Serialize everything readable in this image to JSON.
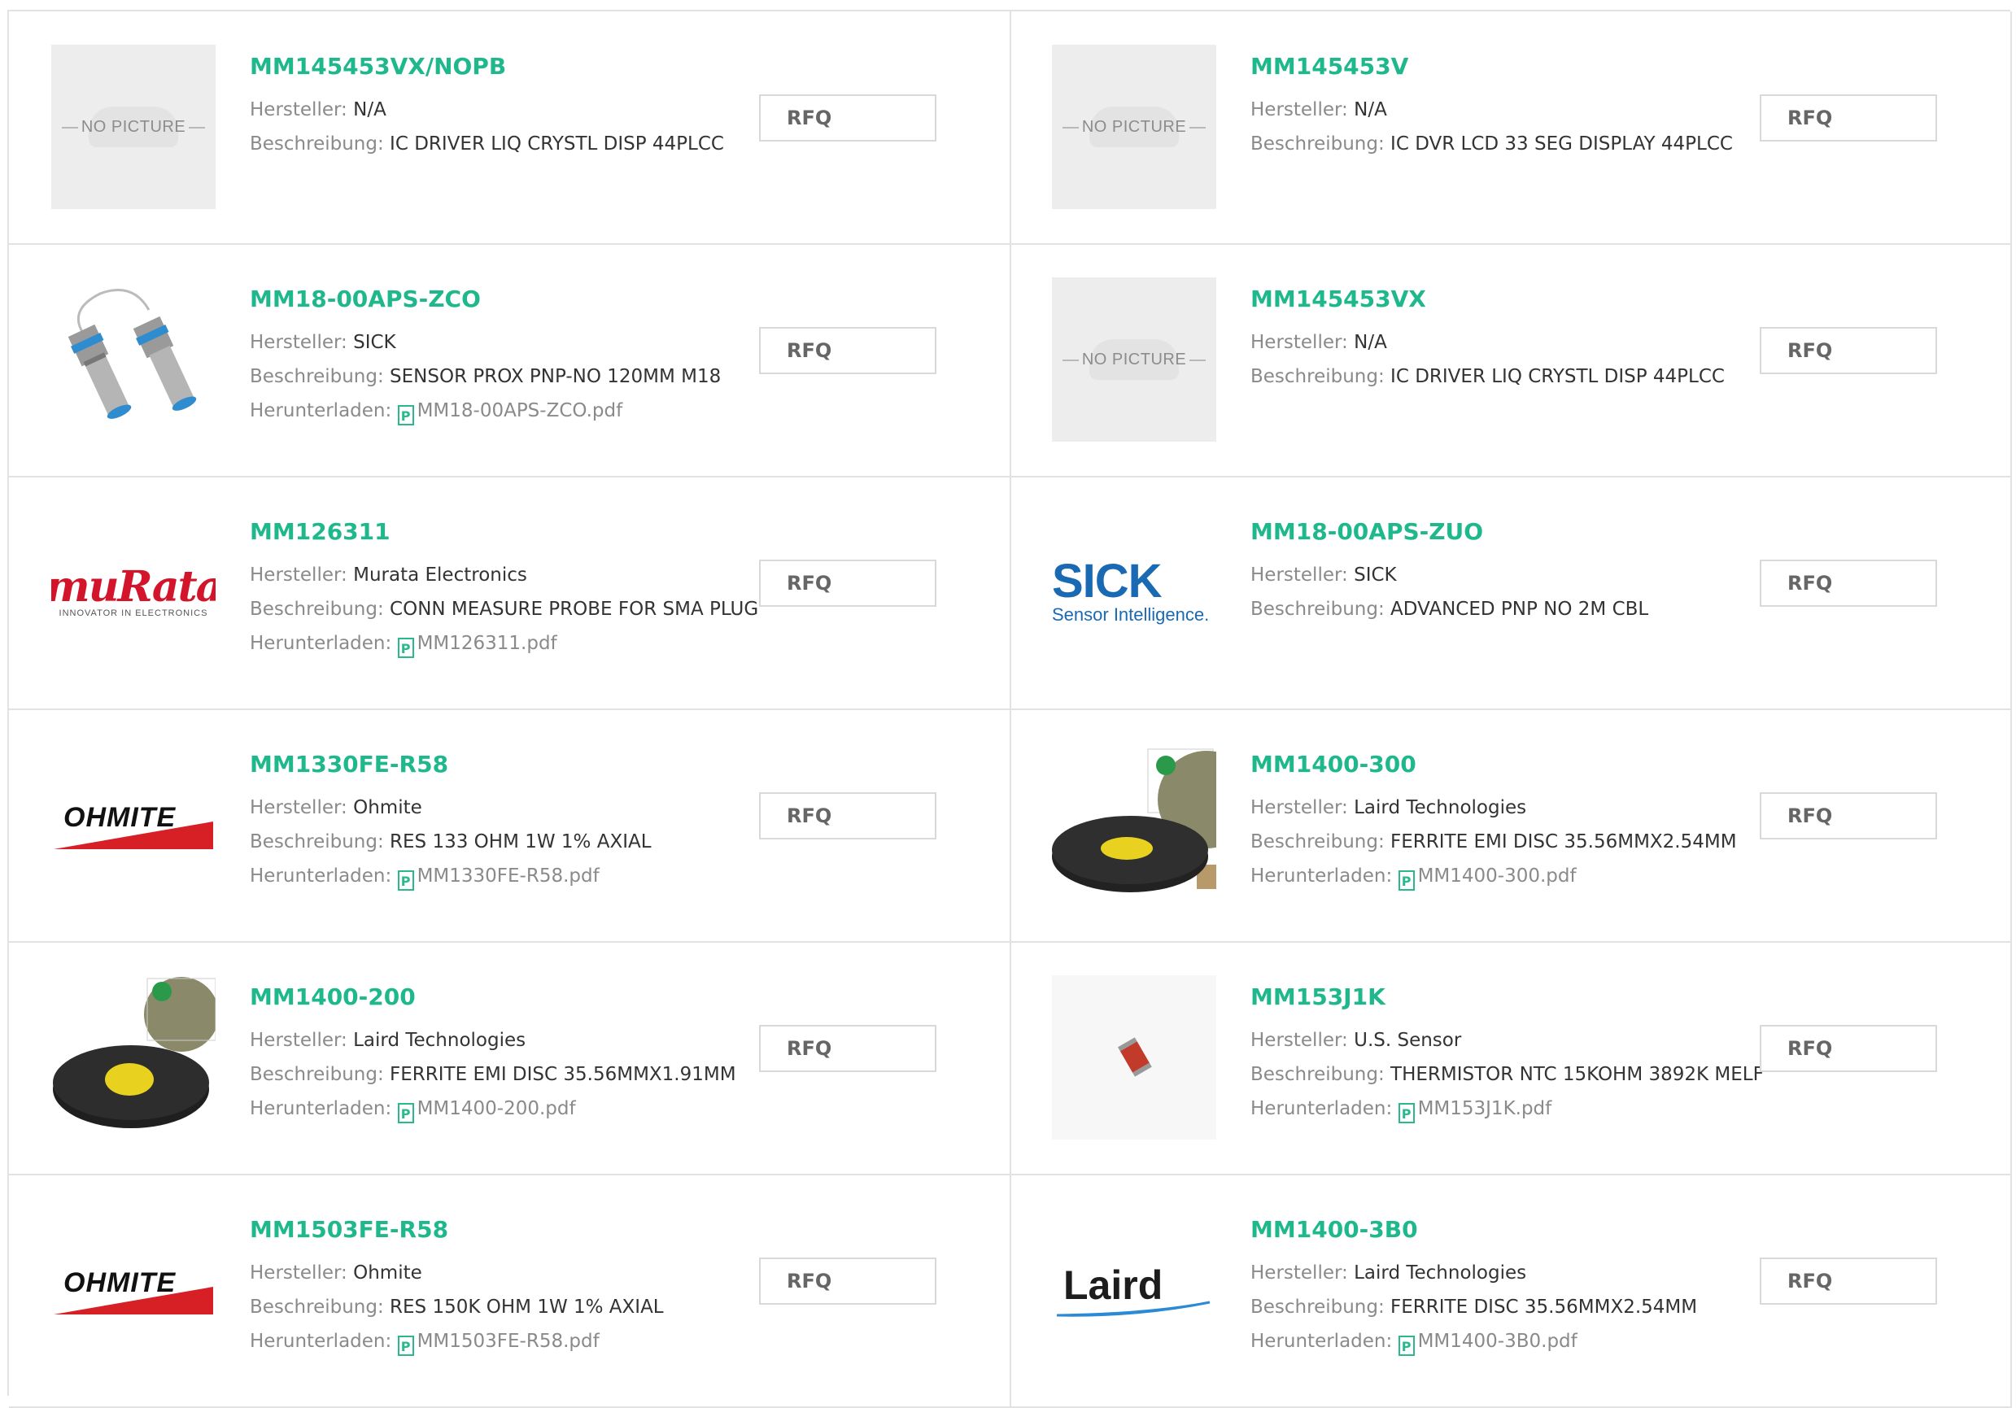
{
  "labels": {
    "manufacturer": "Hersteller:",
    "description": "Beschreibung:",
    "download": "Herunterladen:",
    "rfq": "RFQ",
    "no_picture": "NO PICTURE"
  },
  "logos": {
    "murata": {
      "name": "muRata",
      "tagline": "INNOVATOR IN ELECTRONICS"
    },
    "sick": {
      "name": "SICK",
      "tagline": "Sensor Intelligence."
    },
    "ohmite": {
      "name": "OHMITE"
    },
    "laird": {
      "name": "Laird"
    }
  },
  "colors": {
    "accent": "#1fb88d",
    "label": "#8a8a8a",
    "border": "#e2e2e2"
  },
  "products": [
    {
      "part": "MM145453VX/NOPB",
      "manufacturer": "N/A",
      "description": "IC DRIVER LIQ CRYSTL DISP 44PLCC",
      "pdf": "",
      "image": "no-picture"
    },
    {
      "part": "MM145453V",
      "manufacturer": "N/A",
      "description": "IC DVR LCD 33 SEG DISPLAY 44PLCC",
      "pdf": "",
      "image": "no-picture"
    },
    {
      "part": "MM18-00APS-ZCO",
      "manufacturer": "SICK",
      "description": "SENSOR PROX PNP-NO 120MM M18",
      "pdf": "MM18-00APS-ZCO.pdf",
      "image": "proximity-sensor"
    },
    {
      "part": "MM145453VX",
      "manufacturer": "N/A",
      "description": "IC DRIVER LIQ CRYSTL DISP 44PLCC",
      "pdf": "",
      "image": "no-picture"
    },
    {
      "part": "MM126311",
      "manufacturer": "Murata Electronics",
      "description": "CONN MEASURE PROBE FOR SMA PLUG",
      "pdf": "MM126311.pdf",
      "image": "murata-logo"
    },
    {
      "part": "MM18-00APS-ZUO",
      "manufacturer": "SICK",
      "description": "ADVANCED PNP NO 2M CBL",
      "pdf": "",
      "image": "sick-logo"
    },
    {
      "part": "MM1330FE-R58",
      "manufacturer": "Ohmite",
      "description": "RES 133 OHM 1W 1% AXIAL",
      "pdf": "MM1330FE-R58.pdf",
      "image": "ohmite-logo"
    },
    {
      "part": "MM1400-300",
      "manufacturer": "Laird Technologies",
      "description": "FERRITE EMI DISC 35.56MMX2.54MM",
      "pdf": "MM1400-300.pdf",
      "image": "ferrite-disc"
    },
    {
      "part": "MM1400-200",
      "manufacturer": "Laird Technologies",
      "description": "FERRITE EMI DISC 35.56MMX1.91MM",
      "pdf": "MM1400-200.pdf",
      "image": "ferrite-disc"
    },
    {
      "part": "MM153J1K",
      "manufacturer": "U.S. Sensor",
      "description": "THERMISTOR NTC 15KOHM 3892K MELF",
      "pdf": "MM153J1K.pdf",
      "image": "thermistor"
    },
    {
      "part": "MM1503FE-R58",
      "manufacturer": "Ohmite",
      "description": "RES 150K OHM 1W 1% AXIAL",
      "pdf": "MM1503FE-R58.pdf",
      "image": "ohmite-logo"
    },
    {
      "part": "MM1400-3B0",
      "manufacturer": "Laird Technologies",
      "description": "FERRITE DISC 35.56MMX2.54MM",
      "pdf": "MM1400-3B0.pdf",
      "image": "laird-logo"
    }
  ]
}
